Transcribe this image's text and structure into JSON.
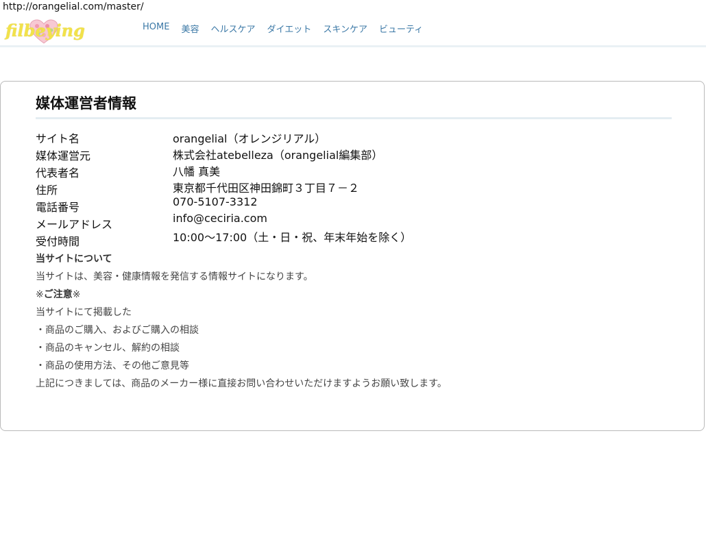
{
  "url": "http://orangelial.com/master/",
  "logo": {
    "text": "filbeying",
    "heart_color": "#f4a3b5"
  },
  "nav": [
    "HOME",
    "美容",
    "ヘルスケア",
    "ダイエット",
    "スキンケア",
    "ビューティ"
  ],
  "card": {
    "title": "媒体運営者情報",
    "rows": [
      {
        "label": "サイト名",
        "value": "orangelial（オレンジリアル）"
      },
      {
        "label": "媒体運営元",
        "value": "株式会社atebelleza（orangelial編集部）"
      },
      {
        "label": "代表者名",
        "value": "八幡 真美"
      },
      {
        "label": "住所",
        "value": "東京都千代田区神田錦町３丁目７－２"
      },
      {
        "label": "電話番号",
        "value": "070-5107-3312"
      },
      {
        "label": "メールアドレス",
        "value": "info@ceciria.com"
      },
      {
        "label": "受付時間",
        "value": "10:00～17:00（土・日・祝、年末年始を除く）"
      }
    ],
    "notes": {
      "about_heading": "当サイトについて",
      "about_text": "当サイトは、美容・健康情報を発信する情報サイトになります。",
      "caution_prefix": "※",
      "caution_heading": "ご注意",
      "caution_suffix": "※",
      "posted_intro": "当サイトにて掲載した",
      "bullets": [
        "・商品のご購入、およびご購入の相談",
        "・商品のキャンセル、解約の相談",
        "・商品の使用方法、その他ご意見等"
      ],
      "closing": "上記につきましては、商品のメーカー様に直接お問い合わせいただけますようお願い致します。"
    }
  },
  "colors": {
    "nav_link": "#3b78a6",
    "logo_text": "#f2e24a",
    "card_border": "#b9b9b9",
    "rule": "#e4edf2"
  }
}
